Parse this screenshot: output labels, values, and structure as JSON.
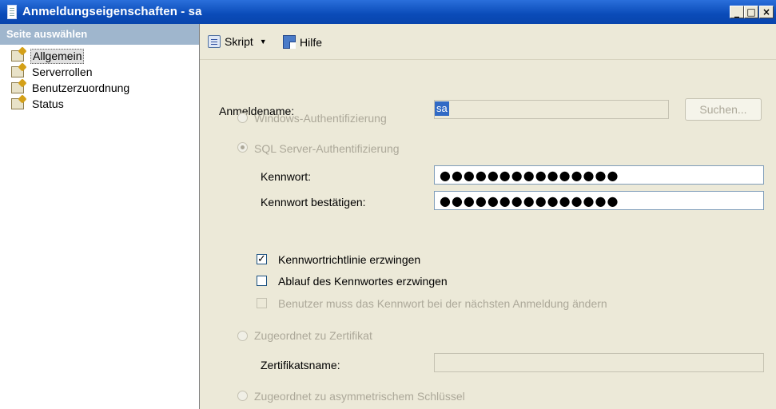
{
  "window": {
    "title": "Anmeldungseigenschaften - sa",
    "controls": {
      "minimize": "_",
      "maximize": "□",
      "close": "×"
    }
  },
  "left_pane": {
    "header": "Seite auswählen",
    "items": [
      {
        "label": "Allgemein",
        "selected": true
      },
      {
        "label": "Serverrollen",
        "selected": false
      },
      {
        "label": "Benutzerzuordnung",
        "selected": false
      },
      {
        "label": "Status",
        "selected": false
      }
    ]
  },
  "toolbar": {
    "script_label": "Skript",
    "help_label": "Hilfe"
  },
  "form": {
    "login_name_label": "Anmeldename:",
    "login_name_value": "sa",
    "search_button": "Suchen...",
    "windows_auth_label": "Windows-Authentifizierung",
    "sql_auth_label": "SQL Server-Authentifizierung",
    "password_label": "Kennwort:",
    "password_value": "●●●●●●●●●●●●●●●",
    "confirm_password_label": "Kennwort bestätigen:",
    "confirm_password_value": "●●●●●●●●●●●●●●●",
    "enforce_policy_label": "Kennwortrichtlinie erzwingen",
    "enforce_policy_checked": true,
    "enforce_expiration_label": "Ablauf des Kennwortes erzwingen",
    "enforce_expiration_checked": false,
    "must_change_label": "Benutzer muss das Kennwort bei der nächsten Anmeldung ändern",
    "must_change_checked": false,
    "certificate_mapped_label": "Zugeordnet zu Zertifikat",
    "certificate_name_label": "Zertifikatsname:",
    "certificate_name_value": "",
    "asymmetric_key_label": "Zugeordnet zu asymmetrischem Schlüssel"
  },
  "colors": {
    "title_bar": "#0A4BB8",
    "pane_header": "#9FB6CD",
    "selection": "#316AC5",
    "window_bg": "#ECE9D8"
  }
}
